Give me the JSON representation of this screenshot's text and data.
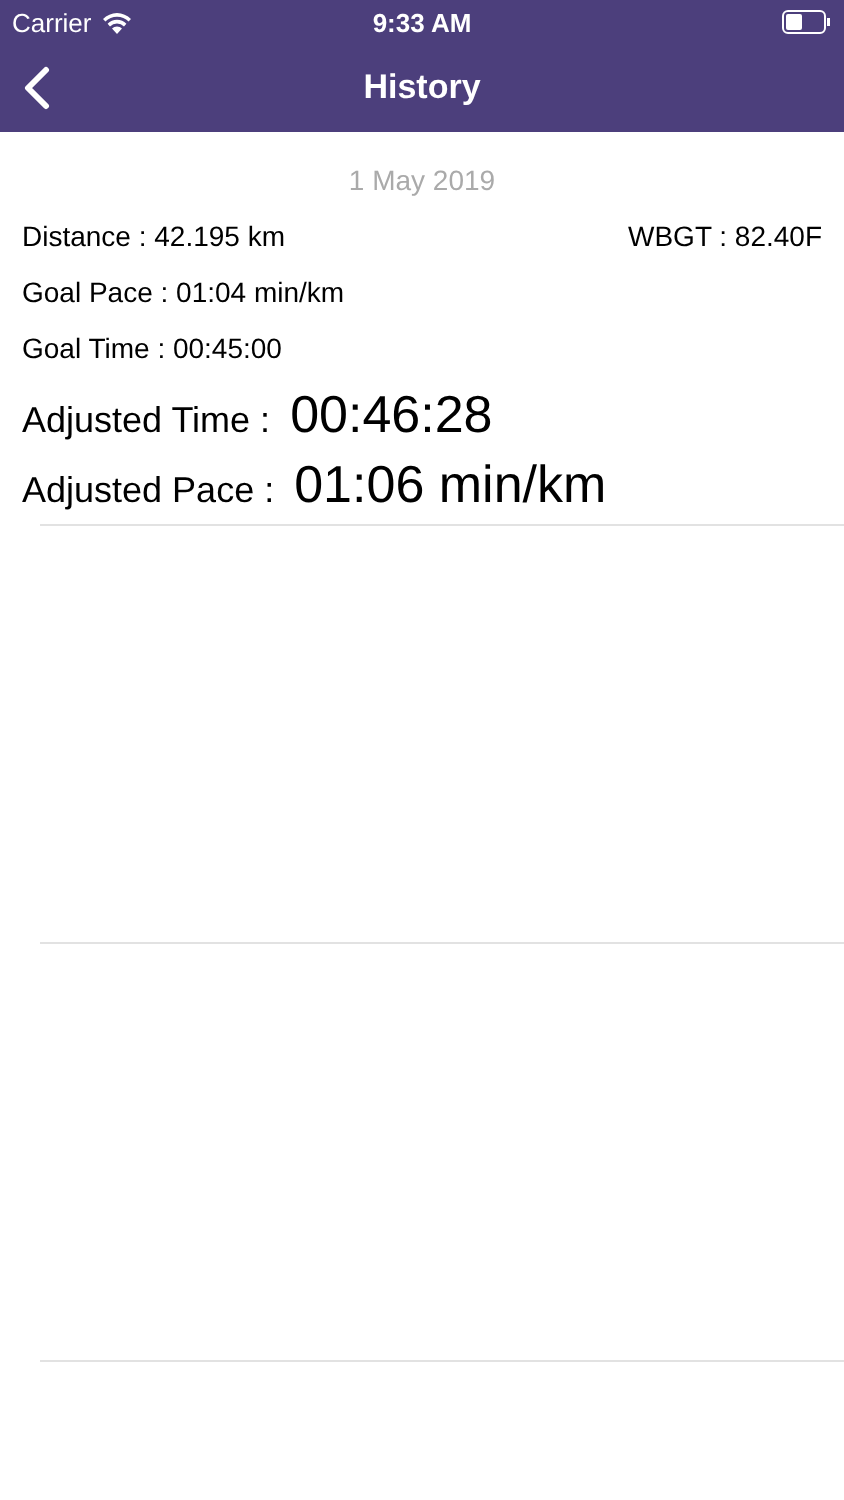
{
  "status_bar": {
    "carrier": "Carrier",
    "time": "9:33 AM"
  },
  "nav": {
    "title": "History"
  },
  "record": {
    "date": "1 May 2019",
    "distance": "Distance : 42.195 km",
    "wbgt": "WBGT : 82.40F",
    "goal_pace": "Goal Pace : 01:04 min/km",
    "goal_time": "Goal Time : 00:45:00",
    "adjusted_time_label": "Adjusted Time :",
    "adjusted_time": "00:46:28",
    "adjusted_pace_label": "Adjusted Pace :",
    "adjusted_pace": "01:06 min/km"
  }
}
